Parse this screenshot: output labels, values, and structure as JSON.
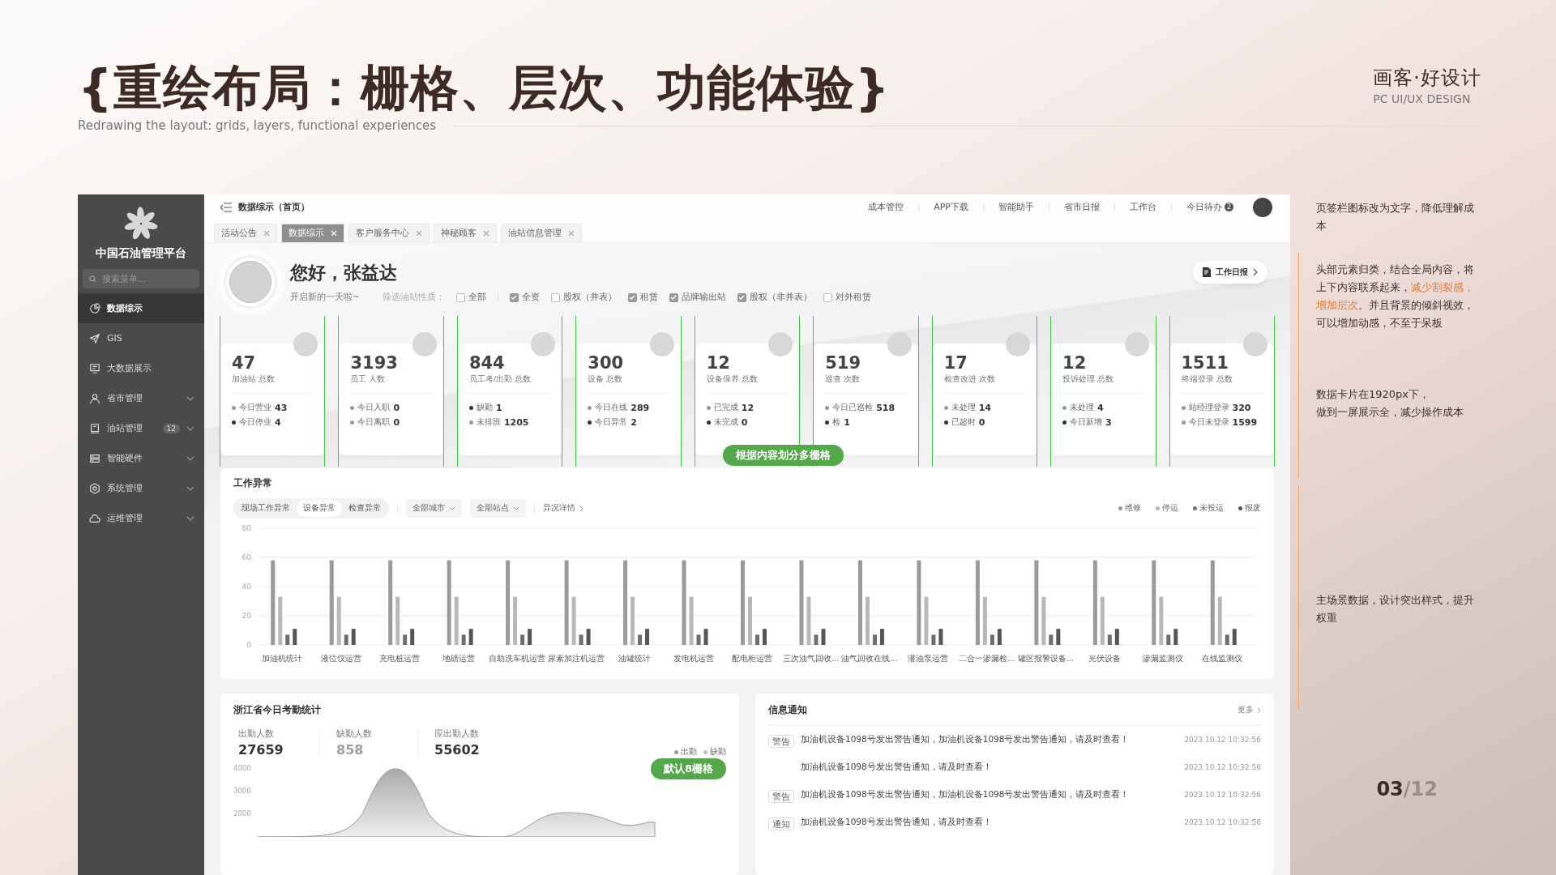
{
  "slide": {
    "title": "{重绘布局：栅格、层次、功能体验}",
    "subtitle": "Redrawing the layout: grids, layers, functional experiences",
    "brand": "画客·好设计",
    "brand_sub": "PC UI/UX DESIGN",
    "page_current": "03",
    "page_total": "/12"
  },
  "sidebar": {
    "app_name": "中国石油管理平台",
    "search_placeholder": "搜索菜单...",
    "items": [
      {
        "label": "数据综示",
        "kind": "link",
        "selected": true
      },
      {
        "label": "GIS",
        "kind": "link",
        "selected": false
      },
      {
        "label": "大数据展示",
        "kind": "link",
        "selected": false
      },
      {
        "label": "省市管理",
        "kind": "group",
        "selected": false
      },
      {
        "label": "油站管理",
        "kind": "group",
        "badge": "12",
        "selected": false
      },
      {
        "label": "智能硬件",
        "kind": "group",
        "selected": false
      },
      {
        "label": "系统管理",
        "kind": "group",
        "selected": false
      },
      {
        "label": "运维管理",
        "kind": "group",
        "selected": false
      }
    ]
  },
  "topbar": {
    "breadcrumb": "数据综示（首页）",
    "links": [
      "成本管控",
      "APP下载",
      "智能助手",
      "省市日报",
      "工作台"
    ],
    "todo": {
      "label": "今日待办",
      "badge": "2"
    }
  },
  "tabs": [
    {
      "label": "活动公告",
      "selected": false
    },
    {
      "label": "数据综示",
      "selected": true
    },
    {
      "label": "客户服务中心",
      "selected": false
    },
    {
      "label": "神秘顾客",
      "selected": false
    },
    {
      "label": "油站信息管理",
      "selected": false
    }
  ],
  "greeting": {
    "title": "您好，张益达",
    "subtitle": "开启新的一天啦~",
    "filter_label": "筛选油站性质：",
    "filters": [
      {
        "label": "全部",
        "checked": false
      },
      {
        "label": "全资",
        "checked": true
      },
      {
        "label": "股权（并表）",
        "checked": false
      },
      {
        "label": "租赁",
        "checked": true
      },
      {
        "label": "品牌输出站",
        "checked": true
      },
      {
        "label": "股权（非并表）",
        "checked": true
      },
      {
        "label": "对外租赁",
        "checked": false
      }
    ],
    "report_button": "工作日报"
  },
  "cards": [
    {
      "value": "47",
      "label": "加油站 总数",
      "stats": [
        {
          "label": "今日营业",
          "value": "43",
          "color": "#9a9a9a"
        },
        {
          "label": "今日停业",
          "value": "4",
          "color": "#333333"
        }
      ]
    },
    {
      "value": "3193",
      "label": "员工 人数",
      "stats": [
        {
          "label": "今日入职",
          "value": "0",
          "color": "#9a9a9a"
        },
        {
          "label": "今日离职",
          "value": "0",
          "color": "#9a9a9a"
        }
      ]
    },
    {
      "value": "844",
      "label": "员工考/出勤 总数",
      "stats": [
        {
          "label": "缺勤",
          "value": "1",
          "color": "#333333"
        },
        {
          "label": "未排班",
          "value": "1205",
          "color": "#9a9a9a"
        }
      ]
    },
    {
      "value": "300",
      "label": "设备 总数",
      "stats": [
        {
          "label": "今日在线",
          "value": "289",
          "color": "#9a9a9a"
        },
        {
          "label": "今日异常",
          "value": "2",
          "color": "#333333"
        }
      ]
    },
    {
      "value": "12",
      "label": "设备保养 总数",
      "stats": [
        {
          "label": "已完成",
          "value": "12",
          "color": "#9a9a9a"
        },
        {
          "label": "未完成",
          "value": "0",
          "color": "#333333"
        }
      ]
    },
    {
      "value": "519",
      "label": "巡查 次数",
      "stats": [
        {
          "label": "今日已巡检",
          "value": "518",
          "color": "#9a9a9a"
        },
        {
          "label": "检",
          "value": "1",
          "color": "#333333"
        }
      ]
    },
    {
      "value": "17",
      "label": "检查改进 次数",
      "stats": [
        {
          "label": "未处理",
          "value": "14",
          "color": "#9a9a9a"
        },
        {
          "label": "已超时",
          "value": "0",
          "color": "#333333"
        }
      ]
    },
    {
      "value": "12",
      "label": "投诉处理 总数",
      "stats": [
        {
          "label": "未处理",
          "value": "4",
          "color": "#9a9a9a"
        },
        {
          "label": "今日新增",
          "value": "3",
          "color": "#333333"
        }
      ]
    },
    {
      "value": "1511",
      "label": "终端登录 总数",
      "stats": [
        {
          "label": "站经理登录",
          "value": "320",
          "color": "#9a9a9a"
        },
        {
          "label": "今日未登录",
          "value": "1599",
          "color": "#9a9a9a"
        }
      ]
    }
  ],
  "overlay_labels": [
    "根据内容划分多栅格",
    "默认8栅格"
  ],
  "anomaly": {
    "title": "工作异常",
    "segments": [
      {
        "label": "现场工作异常",
        "selected": false
      },
      {
        "label": "设备异常",
        "selected": true
      },
      {
        "label": "检查异常",
        "selected": false
      }
    ],
    "filters": [
      "全部城市",
      "全部站点"
    ],
    "details_link": "异况详情",
    "chart_data": {
      "type": "bar",
      "categories": [
        "加油机统计",
        "液位仪运营",
        "充电桩运营",
        "地磅运营",
        "自助洗车机运营",
        "尿素加注机运营",
        "油罐统计",
        "发电机运营",
        "配电柜运营",
        "三次油气回收...",
        "油气回收在线...",
        "潜油泵运营",
        "二合一渗漏检...",
        "罐区报警设备...",
        "光伏设备",
        "渗漏监测仪",
        "在线监测仪"
      ],
      "series": [
        {
          "name": "维修",
          "color": "#9a9a9a",
          "values": [
            58,
            58,
            58,
            58,
            58,
            58,
            58,
            58,
            58,
            58,
            58,
            58,
            58,
            58,
            58,
            58,
            58
          ]
        },
        {
          "name": "停运",
          "color": "#b8b8b8",
          "values": [
            33,
            33,
            33,
            33,
            33,
            33,
            33,
            33,
            33,
            33,
            33,
            33,
            33,
            33,
            33,
            33,
            33
          ]
        },
        {
          "name": "未投运",
          "color": "#6e6e6e",
          "values": [
            7,
            7,
            7,
            7,
            7,
            7,
            7,
            7,
            7,
            7,
            7,
            7,
            7,
            7,
            7,
            7,
            7
          ]
        },
        {
          "name": "报废",
          "color": "#555555",
          "values": [
            11,
            11,
            11,
            11,
            11,
            11,
            11,
            11,
            11,
            11,
            11,
            11,
            11,
            11,
            11,
            11,
            11
          ]
        }
      ],
      "ylim": [
        0,
        80
      ],
      "yticks": [
        0,
        20,
        40,
        60,
        80
      ],
      "grid": true
    }
  },
  "attendance": {
    "title": "浙江省今日考勤统计",
    "stats": [
      {
        "label": "出勤人数",
        "value": "27659",
        "color": "#333333"
      },
      {
        "label": "缺勤人数",
        "value": "858",
        "color": "#a0a0a0"
      },
      {
        "label": "应出勤人数",
        "value": "55602",
        "color": "#333333"
      }
    ],
    "legend": [
      {
        "label": "出勤",
        "color": "#999999"
      },
      {
        "label": "缺勤",
        "color": "#bbbbbb"
      }
    ],
    "y_axis": [
      "4000",
      "3000",
      "2000"
    ]
  },
  "notices": {
    "title": "信息通知",
    "more": "更多",
    "items": [
      {
        "tag": "警告",
        "text": "加油机设备1098号发出警告通知，加油机设备1098号发出警告通知，请及时查看！",
        "time": "2023.10.12 10:32:56"
      },
      {
        "text": "加油机设备1098号发出警告通知，请及时查看！",
        "time": "2023.10.12 10:32:56"
      },
      {
        "tag": "警告",
        "text": "加油机设备1098号发出警告通知，加油机设备1098号发出警告通知，请及时查看！",
        "time": "2023.10.12 10:32:56"
      },
      {
        "tag": "通知",
        "text": "加油机设备1098号发出警告通知，请及时查看！",
        "time": "2023.10.12 10:32:56"
      }
    ]
  },
  "notes": [
    {
      "parts": [
        {
          "text": "页签栏图标改为文字，降低理解成本",
          "highlight": false
        }
      ]
    },
    {
      "parts": [
        {
          "text": "头部元素归类，结合全局内容，将上下内容联系起来，",
          "highlight": false
        },
        {
          "text": "减少割裂感，增加层次",
          "highlight": true
        },
        {
          "text": "。并且背景的倾斜视效，可以增加动感，不至于呆板",
          "highlight": false
        }
      ]
    },
    {
      "parts": [
        {
          "text": "数据卡片在1920px下，",
          "highlight": false
        },
        {
          "text": "做到一屏展示全，减少操作成本",
          "highlight": false,
          "newline": true
        }
      ]
    },
    {
      "parts": [
        {
          "text": "主场景数据，设计突出样式，提升权重",
          "highlight": false
        }
      ]
    }
  ]
}
